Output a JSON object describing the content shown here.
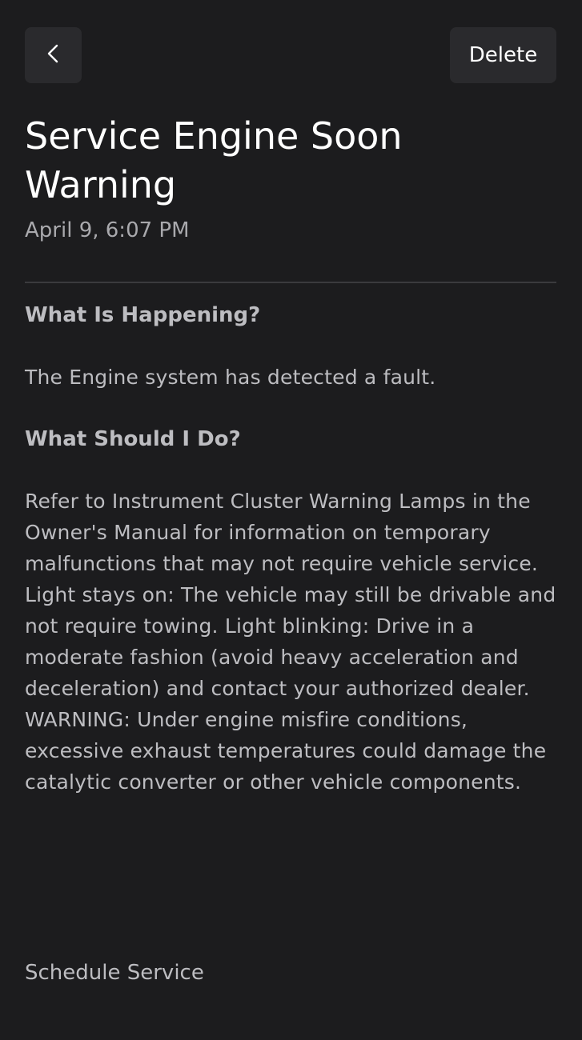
{
  "header": {
    "back_icon": "chevron-left-icon",
    "delete_label": "Delete"
  },
  "notification": {
    "title": "Service Engine Soon Warning",
    "timestamp": "April 9, 6:07 PM"
  },
  "sections": [
    {
      "heading": "What Is Happening?",
      "body": "The Engine system has detected a fault."
    },
    {
      "heading": "What Should I Do?",
      "body": "Refer to Instrument Cluster Warning Lamps in the Owner's Manual for information on temporary malfunctions that may not require vehicle service. Light stays on: The vehicle may still be drivable and not require towing. Light blinking: Drive in a moderate fashion (avoid heavy acceleration and deceleration) and contact your authorized dealer. WARNING: Under engine misfire conditions, excessive exhaust temperatures could damage the catalytic converter or other vehicle components."
    }
  ],
  "actions": {
    "schedule_service_label": "Schedule Service"
  },
  "colors": {
    "background": "#1c1c1e",
    "button_background": "#2a2a2d",
    "primary_text": "#ffffff",
    "secondary_text": "#bdbdc1"
  }
}
